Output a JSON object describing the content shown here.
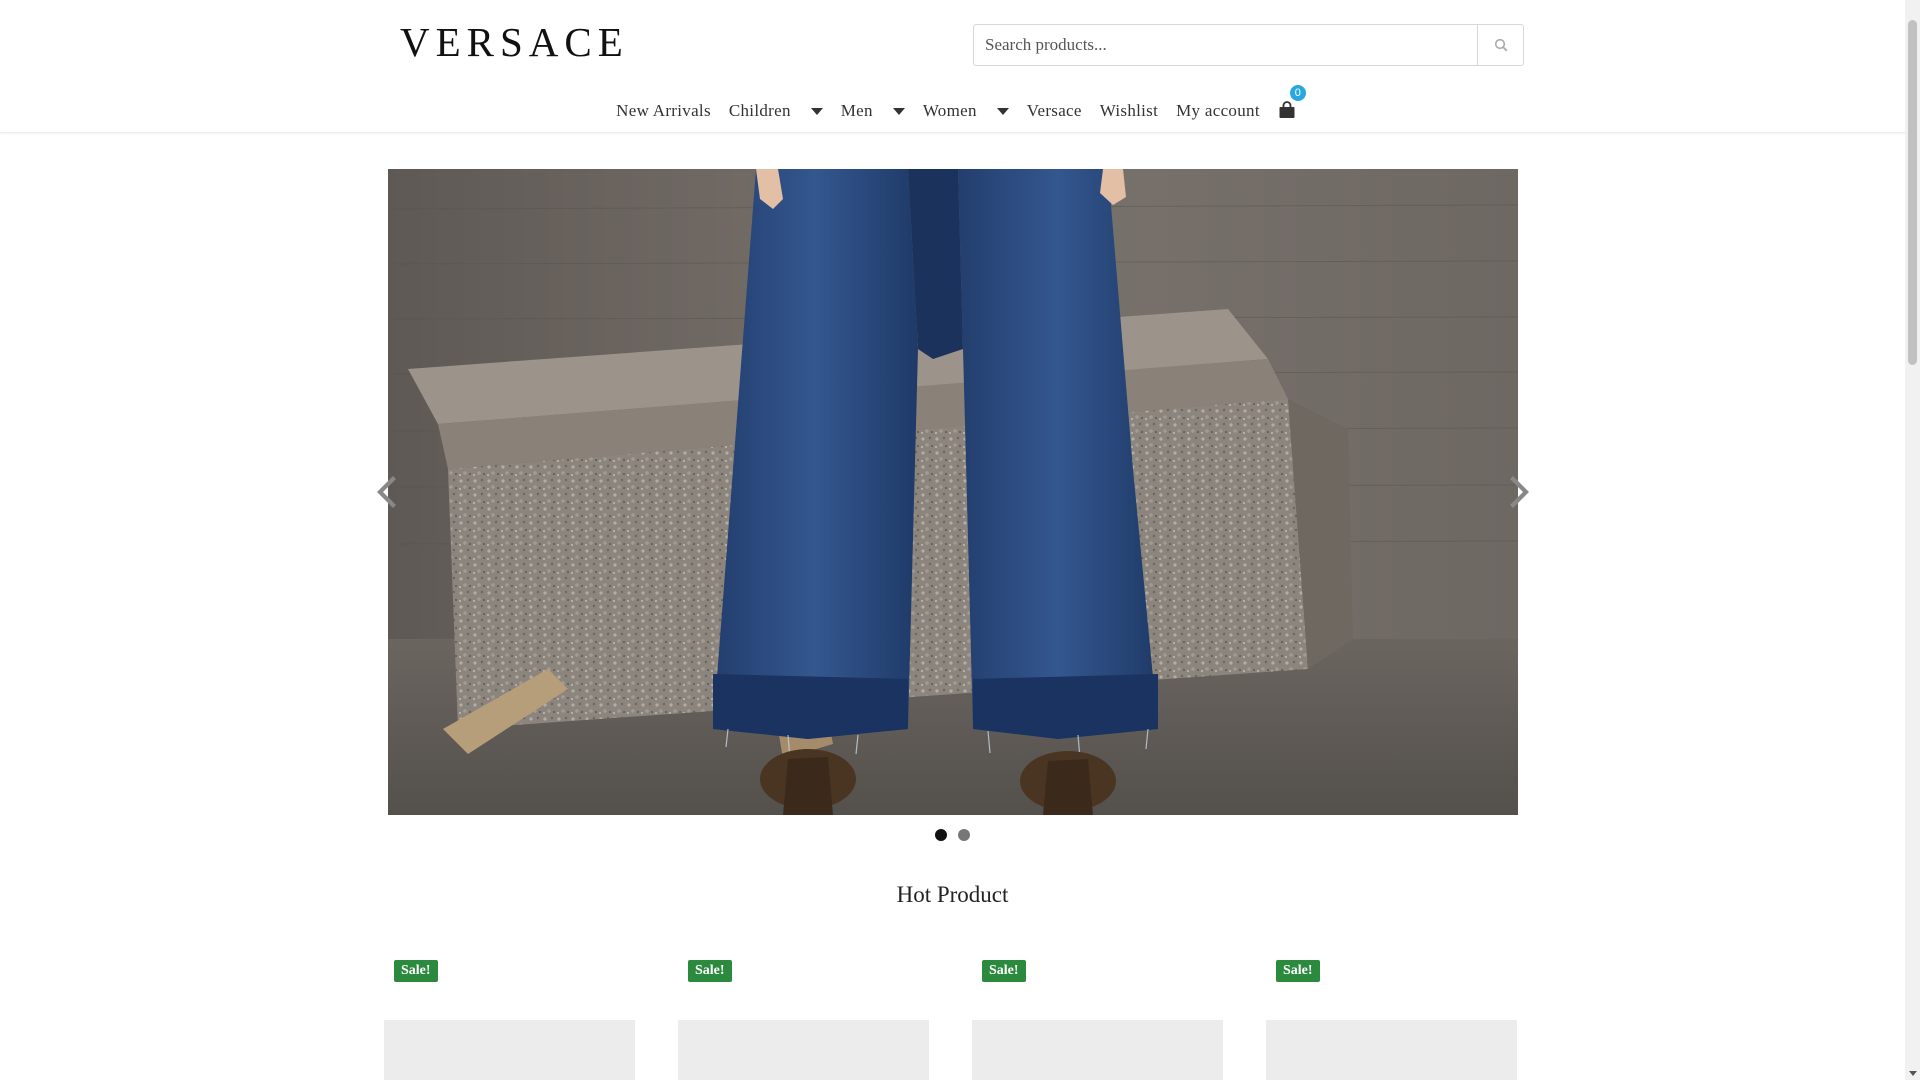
{
  "brand": {
    "logo_text": "VERSACE"
  },
  "search": {
    "placeholder": "Search products...",
    "icon": "search-icon"
  },
  "nav": {
    "items": [
      {
        "label": "New Arrivals",
        "dropdown": false
      },
      {
        "label": "Children",
        "dropdown": true
      },
      {
        "label": "Men",
        "dropdown": true
      },
      {
        "label": "Women",
        "dropdown": true
      },
      {
        "label": "Versace",
        "dropdown": false
      },
      {
        "label": "Wishlist",
        "dropdown": false
      },
      {
        "label": "My account",
        "dropdown": false
      }
    ],
    "cart_count": "0",
    "cart_icon": "shopping-bag-icon"
  },
  "slider": {
    "slide_count": 2,
    "active_slide": 1,
    "prev_icon": "chevron-left-icon",
    "next_icon": "chevron-right-icon"
  },
  "hot_products": {
    "title": "Hot Product",
    "items": [
      {
        "badge": "Sale!"
      },
      {
        "badge": "Sale!"
      },
      {
        "badge": "Sale!"
      },
      {
        "badge": "Sale!"
      }
    ]
  },
  "colors": {
    "sale_badge": "#2b8a3e",
    "cart_badge": "#29a7e1",
    "text": "#333333"
  }
}
